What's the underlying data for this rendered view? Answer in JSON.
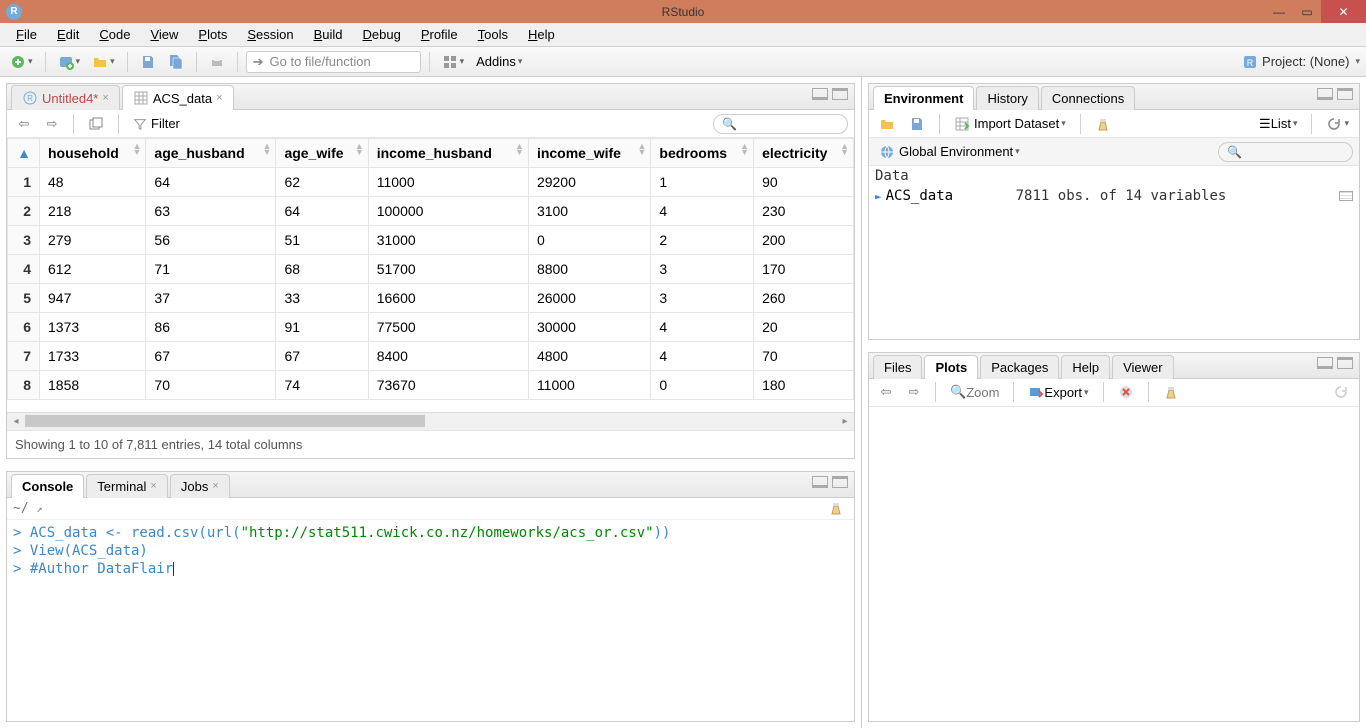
{
  "window": {
    "title": "RStudio"
  },
  "menu": [
    "File",
    "Edit",
    "Code",
    "View",
    "Plots",
    "Session",
    "Build",
    "Debug",
    "Profile",
    "Tools",
    "Help"
  ],
  "toolbar": {
    "goto_placeholder": "Go to file/function",
    "addins": "Addins",
    "project": "Project: (None)"
  },
  "source": {
    "tabs": [
      {
        "label": "Untitled4*",
        "modified": true
      },
      {
        "label": "ACS_data",
        "modified": false
      }
    ],
    "filter_label": "Filter",
    "columns": [
      "household",
      "age_husband",
      "age_wife",
      "income_husband",
      "income_wife",
      "bedrooms",
      "electricity"
    ],
    "rows": [
      [
        "48",
        "64",
        "62",
        "11000",
        "29200",
        "1",
        "90"
      ],
      [
        "218",
        "63",
        "64",
        "100000",
        "3100",
        "4",
        "230"
      ],
      [
        "279",
        "56",
        "51",
        "31000",
        "0",
        "2",
        "200"
      ],
      [
        "612",
        "71",
        "68",
        "51700",
        "8800",
        "3",
        "170"
      ],
      [
        "947",
        "37",
        "33",
        "16600",
        "26000",
        "3",
        "260"
      ],
      [
        "1373",
        "86",
        "91",
        "77500",
        "30000",
        "4",
        "20"
      ],
      [
        "1733",
        "67",
        "67",
        "8400",
        "4800",
        "4",
        "70"
      ],
      [
        "1858",
        "70",
        "74",
        "73670",
        "11000",
        "0",
        "180"
      ]
    ],
    "footer": "Showing 1 to 10 of 7,811 entries, 14 total columns"
  },
  "console": {
    "tabs": [
      "Console",
      "Terminal",
      "Jobs"
    ],
    "cwd": "~/",
    "lines": [
      {
        "type": "cmd",
        "text_pre": "ACS_data <- read.csv(url(",
        "str": "\"http://stat511.cwick.co.nz/homeworks/acs_or.csv\"",
        "text_post": "))"
      },
      {
        "type": "cmd",
        "text_pre": "View(ACS_data)",
        "str": "",
        "text_post": ""
      },
      {
        "type": "cmd",
        "text_pre": "#Author DataFlair",
        "str": "",
        "text_post": ""
      }
    ]
  },
  "env": {
    "tabs": [
      "Environment",
      "History",
      "Connections"
    ],
    "import_label": "Import Dataset",
    "list_label": "List",
    "scope": "Global Environment",
    "section": "Data",
    "items": [
      {
        "name": "ACS_data",
        "desc": "7811 obs. of 14 variables"
      }
    ]
  },
  "viewer": {
    "tabs": [
      "Files",
      "Plots",
      "Packages",
      "Help",
      "Viewer"
    ],
    "zoom": "Zoom",
    "export": "Export"
  }
}
